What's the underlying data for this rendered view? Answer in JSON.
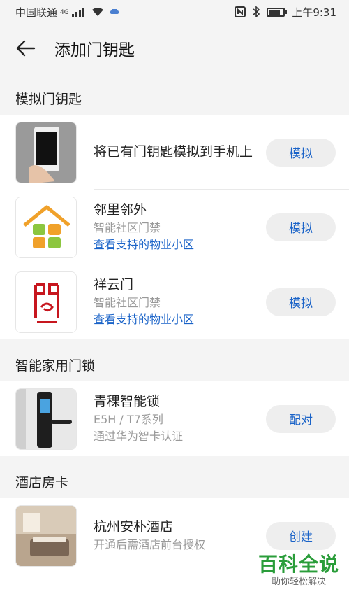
{
  "status_bar": {
    "carrier": "中国联通",
    "network": "4G",
    "time": "上午9:31"
  },
  "app_bar": {
    "title": "添加门钥匙"
  },
  "sections": [
    {
      "header": "模拟门钥匙",
      "items": [
        {
          "name": "将已有门钥匙模拟到手机上",
          "action": "模拟",
          "thumb": "phone-in-hand"
        },
        {
          "name": "邻里邻外",
          "subtitle": "智能社区门禁",
          "link": "查看支持的物业小区",
          "action": "模拟",
          "thumb": "neighbor-house-logo"
        },
        {
          "name": "祥云门",
          "subtitle": "智能社区门禁",
          "link": "查看支持的物业小区",
          "action": "模拟",
          "thumb": "xiangyun-logo"
        }
      ]
    },
    {
      "header": "智能家用门锁",
      "items": [
        {
          "name": "青稞智能锁",
          "subtitle": "E5H / T7系列",
          "subtitle2": "通过华为智卡认证",
          "action": "配对",
          "thumb": "smart-lock"
        }
      ]
    },
    {
      "header": "酒店房卡",
      "items": [
        {
          "name": "杭州安朴酒店",
          "subtitle": "开通后需酒店前台授权",
          "action": "创建",
          "thumb": "hotel-room"
        }
      ]
    }
  ],
  "watermark": {
    "title": "百科全说",
    "subtitle": "助你轻松解决"
  },
  "colors": {
    "accent": "#1a63c8",
    "header_bg": "#f4f4f4",
    "button_bg": "#eeeeee",
    "watermark": "#2a9d3a"
  }
}
